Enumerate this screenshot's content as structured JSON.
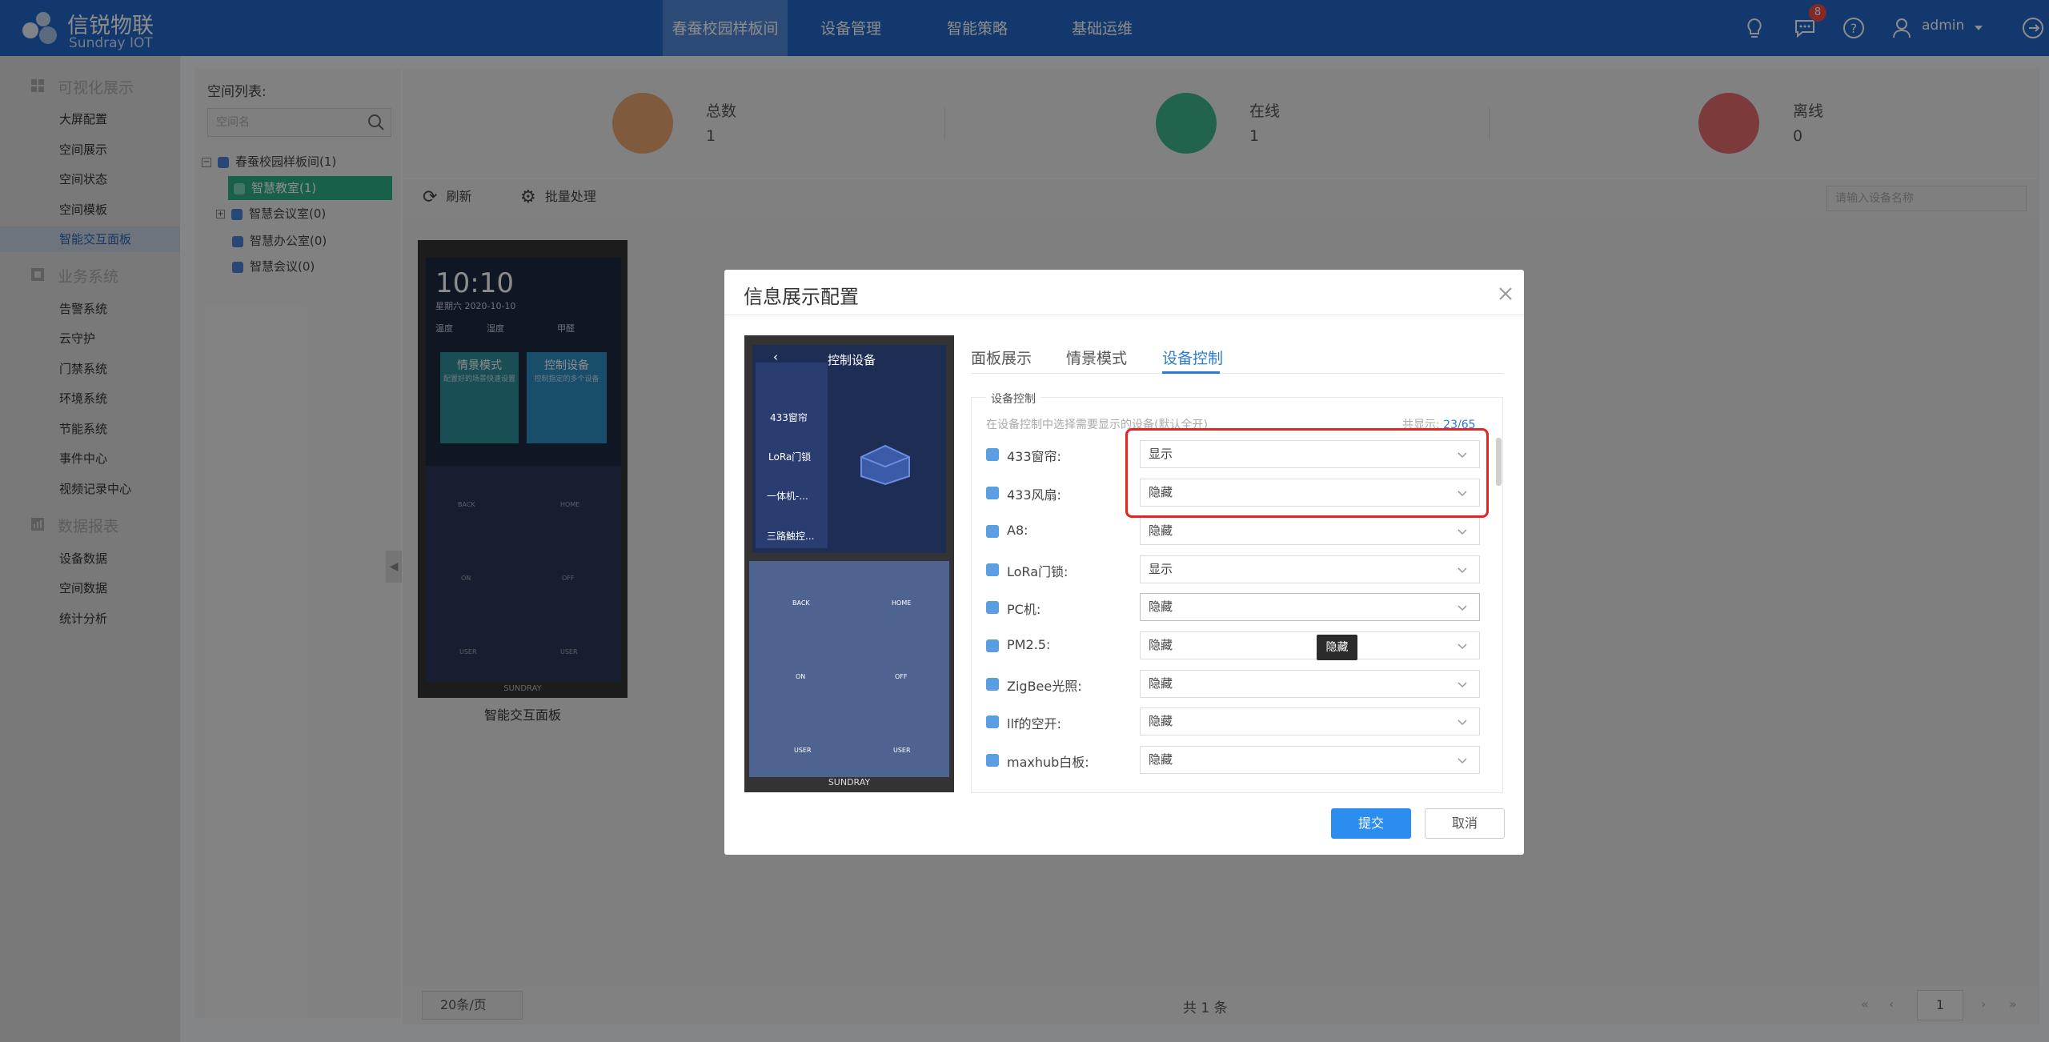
{
  "brand": {
    "name": "信锐物联",
    "sub": "Sundray IOT"
  },
  "nav": {
    "tabs": [
      "春蚕校园样板间",
      "设备管理",
      "智能策略",
      "基础运维"
    ],
    "badge_count": "8",
    "user": "admin"
  },
  "sidebar": {
    "groups": [
      {
        "title": "可视化展示",
        "items": [
          "大屏配置",
          "空间展示",
          "空间状态",
          "空间模板",
          "智能交互面板"
        ]
      },
      {
        "title": "业务系统",
        "items": [
          "告警系统",
          "云守护",
          "门禁系统",
          "环境系统",
          "节能系统",
          "事件中心",
          "视频记录中心"
        ]
      },
      {
        "title": "数据报表",
        "items": [
          "设备数据",
          "空间数据",
          "统计分析"
        ]
      }
    ]
  },
  "space": {
    "title": "空间列表:",
    "search_placeholder": "空间名",
    "tree": [
      "春蚕校园样板间(1)",
      "智慧教室(1)",
      "智慧会议室(0)",
      "智慧办公室(0)",
      "智慧会议(0)"
    ]
  },
  "stats": [
    {
      "label": "总数",
      "value": "1",
      "color": "#e8a570"
    },
    {
      "label": "在线",
      "value": "1",
      "color": "#3fb48e"
    },
    {
      "label": "离线",
      "value": "0",
      "color": "#e36a6a"
    }
  ],
  "toolbar": {
    "refresh": "刷新",
    "batch": "批量处理",
    "search_placeholder": "请输入设备名称"
  },
  "device_card": {
    "time": "10:10",
    "date": "星期六   2020-10-10",
    "sensors": [
      "温度",
      "湿度",
      "甲醛"
    ],
    "tile1": {
      "title": "情景模式",
      "sub": "配置好的场景快速设置"
    },
    "tile2": {
      "title": "控制设备",
      "sub": "控制指定的多个设备"
    },
    "keys": [
      "BACK",
      "HOME",
      "ON",
      "OFF",
      "USER",
      "USER"
    ],
    "brand": "SUNDRAY",
    "name": "智能交互面板"
  },
  "footer": {
    "page_size": "20条/页",
    "total": "共 1 条",
    "page": "1"
  },
  "modal": {
    "title": "信息展示配置",
    "tabs": [
      "面板展示",
      "情景模式",
      "设备控制"
    ],
    "legend": "设备控制",
    "note": "在设备控制中选择需要显示的设备(默认全开)",
    "count_prefix": "共显示:",
    "count_value": "23/65",
    "phone": {
      "title": "控制设备",
      "items": [
        "433窗帘",
        "LoRa门锁",
        "一体机-...",
        "三路触控..."
      ],
      "keys": [
        "BACK",
        "HOME",
        "ON",
        "OFF",
        "USER",
        "USER"
      ],
      "brand": "SUNDRAY"
    },
    "rows": [
      {
        "label": "433窗帘:",
        "value": "显示"
      },
      {
        "label": "433风扇:",
        "value": "隐藏"
      },
      {
        "label": "A8:",
        "value": "隐藏"
      },
      {
        "label": "LoRa门锁:",
        "value": "显示"
      },
      {
        "label": "PC机:",
        "value": "隐藏"
      },
      {
        "label": "PM2.5:",
        "value": "隐藏"
      },
      {
        "label": "ZigBee光照:",
        "value": "隐藏"
      },
      {
        "label": "llf的空开:",
        "value": "隐藏"
      },
      {
        "label": "maxhub白板:",
        "value": "隐藏"
      }
    ],
    "tooltip": "隐藏",
    "submit": "提交",
    "cancel": "取消"
  }
}
